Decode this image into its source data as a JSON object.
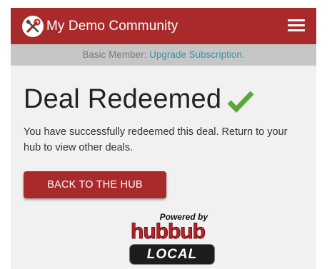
{
  "header": {
    "brand": "My Demo Community",
    "logo_icon": "wrench-screwdriver-icon",
    "menu_icon": "hamburger-menu-icon",
    "color": "#a82a2a"
  },
  "membership": {
    "status": "Basic Member:",
    "upgrade_link": "Upgrade Subscription."
  },
  "deal": {
    "title": "Deal Redeemed",
    "check_icon": "checkmark-icon",
    "check_color": "#5aa63a",
    "message": "You have successfully redeemed this deal. Return to your hub to view other deals."
  },
  "actions": {
    "back_label": "BACK TO THE HUB"
  },
  "footer": {
    "powered_by": "Powered by",
    "logo_word": "hubbub",
    "logo_badge": "LOCAL"
  }
}
